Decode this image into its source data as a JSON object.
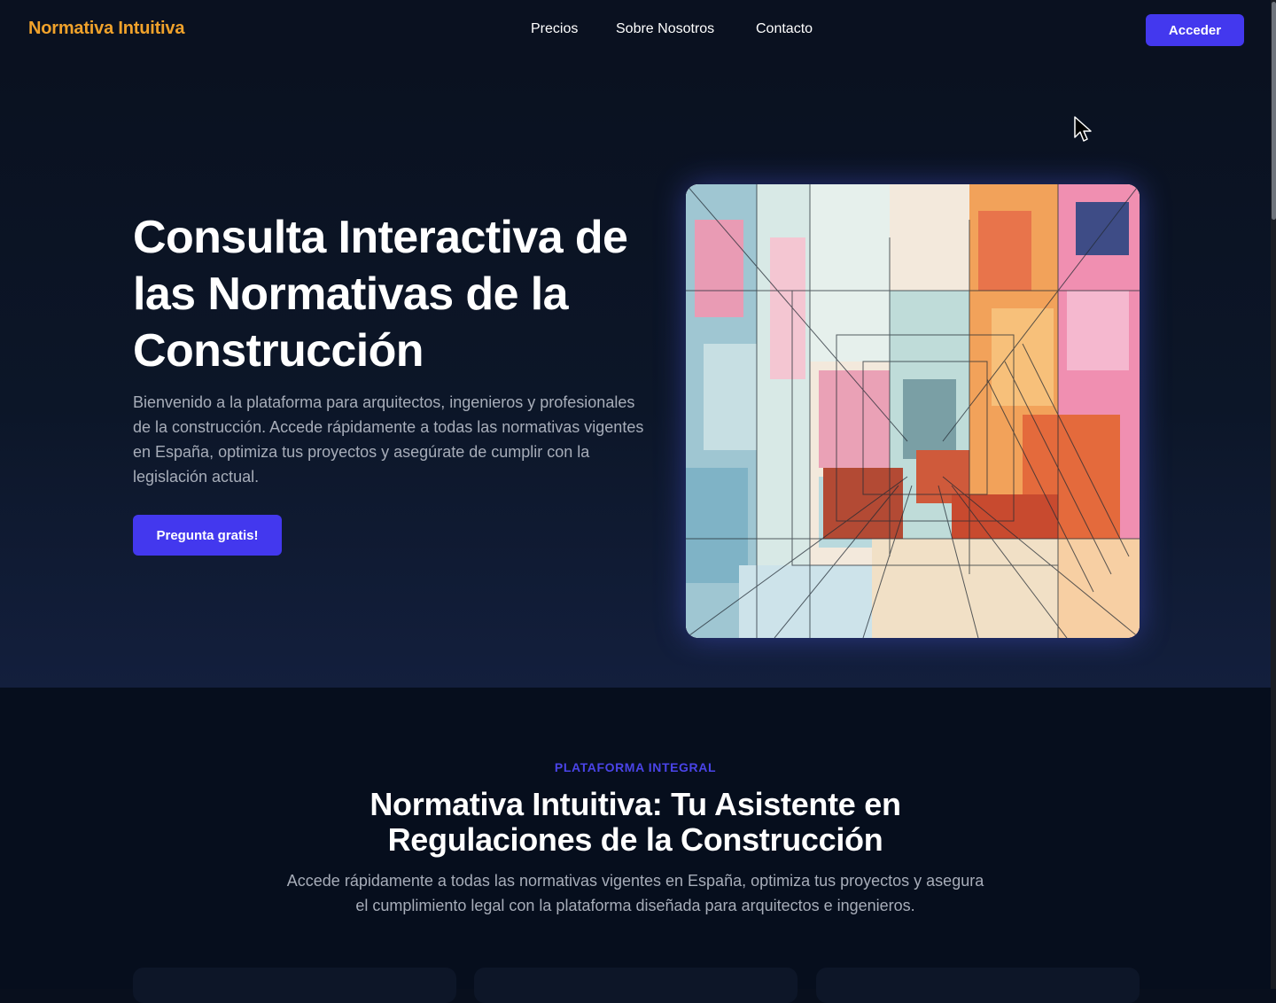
{
  "header": {
    "logo": "Normativa Intuitiva",
    "nav": [
      {
        "label": "Precios"
      },
      {
        "label": "Sobre Nosotros"
      },
      {
        "label": "Contacto"
      }
    ],
    "login_label": "Acceder"
  },
  "hero": {
    "title": "Consulta Interactiva de las Normativas de la Construcción",
    "description": "Bienvenido a la plataforma para arquitectos, ingenieros y profesionales de la construcción. Accede rápidamente a todas las normativas vigentes en España, optimiza tus proyectos y asegúrate de cumplir con la legislación actual.",
    "cta_label": "Pregunta gratis!"
  },
  "section": {
    "eyebrow": "PLATAFORMA INTEGRAL",
    "title": "Normativa Intuitiva: Tu Asistente en Regulaciones de la Construcción",
    "description": "Accede rápidamente a todas las normativas vigentes en España, optimiza tus proyectos y asegura el cumplimiento legal con la plataforma diseñada para arquitectos e ingenieros."
  },
  "colors": {
    "accent": "#4338ee",
    "brand": "#f0a22b",
    "background": "#080f1d",
    "muted_text": "#a7adb9"
  },
  "icons": {
    "cursor": "mouse-pointer-icon"
  }
}
